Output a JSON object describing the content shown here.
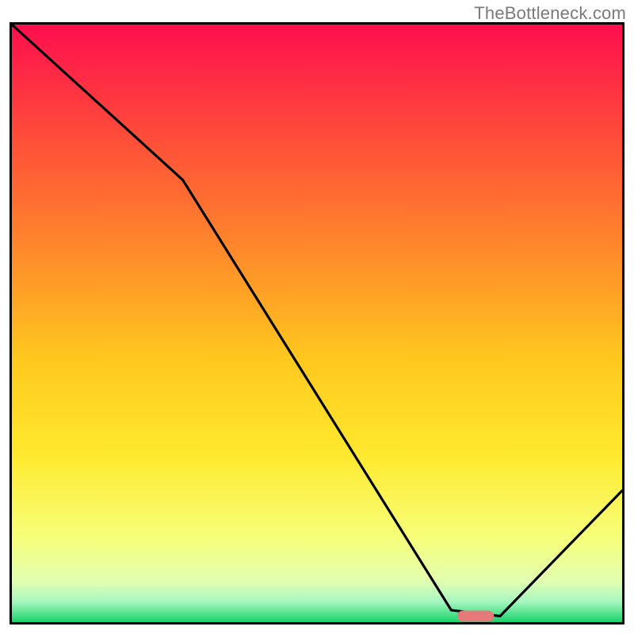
{
  "watermark": "TheBottleneck.com",
  "chart_data": {
    "type": "line",
    "title": "",
    "xlabel": "",
    "ylabel": "",
    "xlim": [
      0,
      100
    ],
    "ylim": [
      0,
      100
    ],
    "grid": false,
    "x": [
      0,
      28,
      72,
      80,
      100
    ],
    "y": [
      100,
      74,
      2,
      1,
      22
    ],
    "series_description": "Single black curve on vertical rainbow gradient background. Curve starts at top-left corner, descends with a slight knee around x≈28, falls roughly linearly to a broad flat minimum near x≈72–80, then rises toward the right edge. A small red/pink capsule marker sits at the flat minimum.",
    "minimum_marker": {
      "x": 76,
      "y": 1,
      "width_pct": 6
    },
    "gradient_stops": [
      {
        "offset": 0.0,
        "color": "#ff0e4e"
      },
      {
        "offset": 0.18,
        "color": "#ff4a3a"
      },
      {
        "offset": 0.38,
        "color": "#ff8a2a"
      },
      {
        "offset": 0.56,
        "color": "#ffc81e"
      },
      {
        "offset": 0.72,
        "color": "#ffe92e"
      },
      {
        "offset": 0.86,
        "color": "#f6ff7a"
      },
      {
        "offset": 0.93,
        "color": "#e3ffb0"
      },
      {
        "offset": 0.965,
        "color": "#a9f7c0"
      },
      {
        "offset": 1.0,
        "color": "#17d36b"
      }
    ]
  }
}
